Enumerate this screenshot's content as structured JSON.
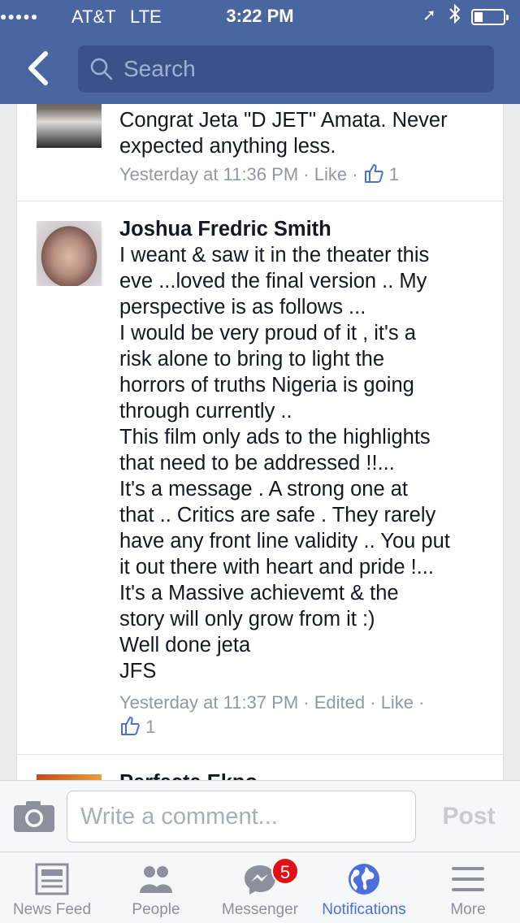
{
  "status_bar": {
    "carrier": "AT&T",
    "network": "LTE",
    "time": "3:22 PM"
  },
  "search": {
    "placeholder": "Search"
  },
  "comments": [
    {
      "text": "Congrat Jeta \"D JET\" Amata. Never expected anything less.",
      "timestamp": "Yesterday at 11:36 PM",
      "like_label": "Like",
      "like_count": "1"
    },
    {
      "author": "Joshua Fredric Smith",
      "lines": [
        "I weant & saw it in the theater this",
        "eve ...loved the final version .. My",
        "perspective is as follows ...",
        "I would be very proud of it , it's a",
        "risk alone to bring to light the",
        "horrors of truths Nigeria is going",
        "through  currently ..",
        "This film only ads to the highlights",
        "that need to be addressed !!...",
        "It's a message . A strong one at",
        "that .. Critics are safe . They rarely",
        "have any front line validity .. You put",
        "it out there with heart and pride !...",
        "It's a Massive  achievemt & the",
        "story will only grow from it :)",
        "Well done jeta",
        "JFS"
      ],
      "timestamp": "Yesterday at 11:37 PM",
      "edited_label": "Edited",
      "like_label": "Like",
      "like_count": "1"
    },
    {
      "author": "Perfecta Ekpo"
    }
  ],
  "composer": {
    "placeholder": "Write a comment...",
    "post_label": "Post"
  },
  "tabs": [
    {
      "label": "News Feed",
      "icon": "news-feed-icon"
    },
    {
      "label": "People",
      "icon": "people-icon"
    },
    {
      "label": "Messenger",
      "icon": "messenger-icon",
      "badge": "5"
    },
    {
      "label": "Notifications",
      "icon": "globe-icon",
      "active": true
    },
    {
      "label": "More",
      "icon": "menu-icon"
    }
  ],
  "colors": {
    "header": "#4a66a0",
    "active_tab": "#4a6fd8",
    "badge": "#e30f16"
  }
}
